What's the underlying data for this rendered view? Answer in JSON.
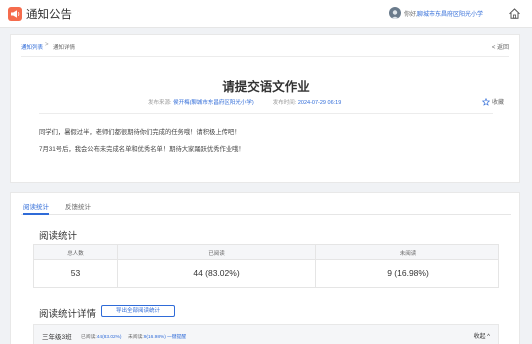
{
  "header": {
    "app_title": "通知公告",
    "greeting": "你好,",
    "school": "聊城市东昌府区阳光小学"
  },
  "breadcrumb": {
    "list": "通知列表",
    "separator": ">",
    "current": "通知详情"
  },
  "back_label": "< 返回",
  "notice": {
    "title": "请提交语文作业",
    "source_label": "发布来源:",
    "source_value": "侯开梅(聊城市东昌府区阳光小学)",
    "time_label": "发布时间:",
    "time_value": "2024-07-29 06:19",
    "favorite_label": "收藏",
    "paragraphs": [
      "同学们，暑假过半，老师们都很期待你们完成的任务哦！请积极上传吧！",
      "7月31号后，我会公布未完成名单和优秀名单！期待大家踊跃优秀作业哦！"
    ]
  },
  "tabs": [
    {
      "label": "阅读统计"
    },
    {
      "label": "反馈统计"
    }
  ],
  "reading_stats": {
    "title": "阅读统计",
    "headers": [
      "总人数",
      "已阅读",
      "未阅读"
    ],
    "values": [
      "53",
      "44 (83.02%)",
      "9 (16.98%)"
    ]
  },
  "details": {
    "title": "阅读统计详情",
    "export_label": "导出全部阅读统计",
    "class_name": "三年级3班",
    "read_label": "已阅读:",
    "read_value": "44(83.02%)",
    "unread_label": "未阅读:",
    "unread_value": "9(16.98%)",
    "remind_label": "一键提醒",
    "collapse_label": "收起 ^"
  },
  "colors": {
    "accent": "#2f6bd8",
    "logo": "#f56c4d",
    "background": "#f0f2f5"
  },
  "icons": [
    "megaphone-icon",
    "avatar",
    "home-icon",
    "star-icon"
  ]
}
